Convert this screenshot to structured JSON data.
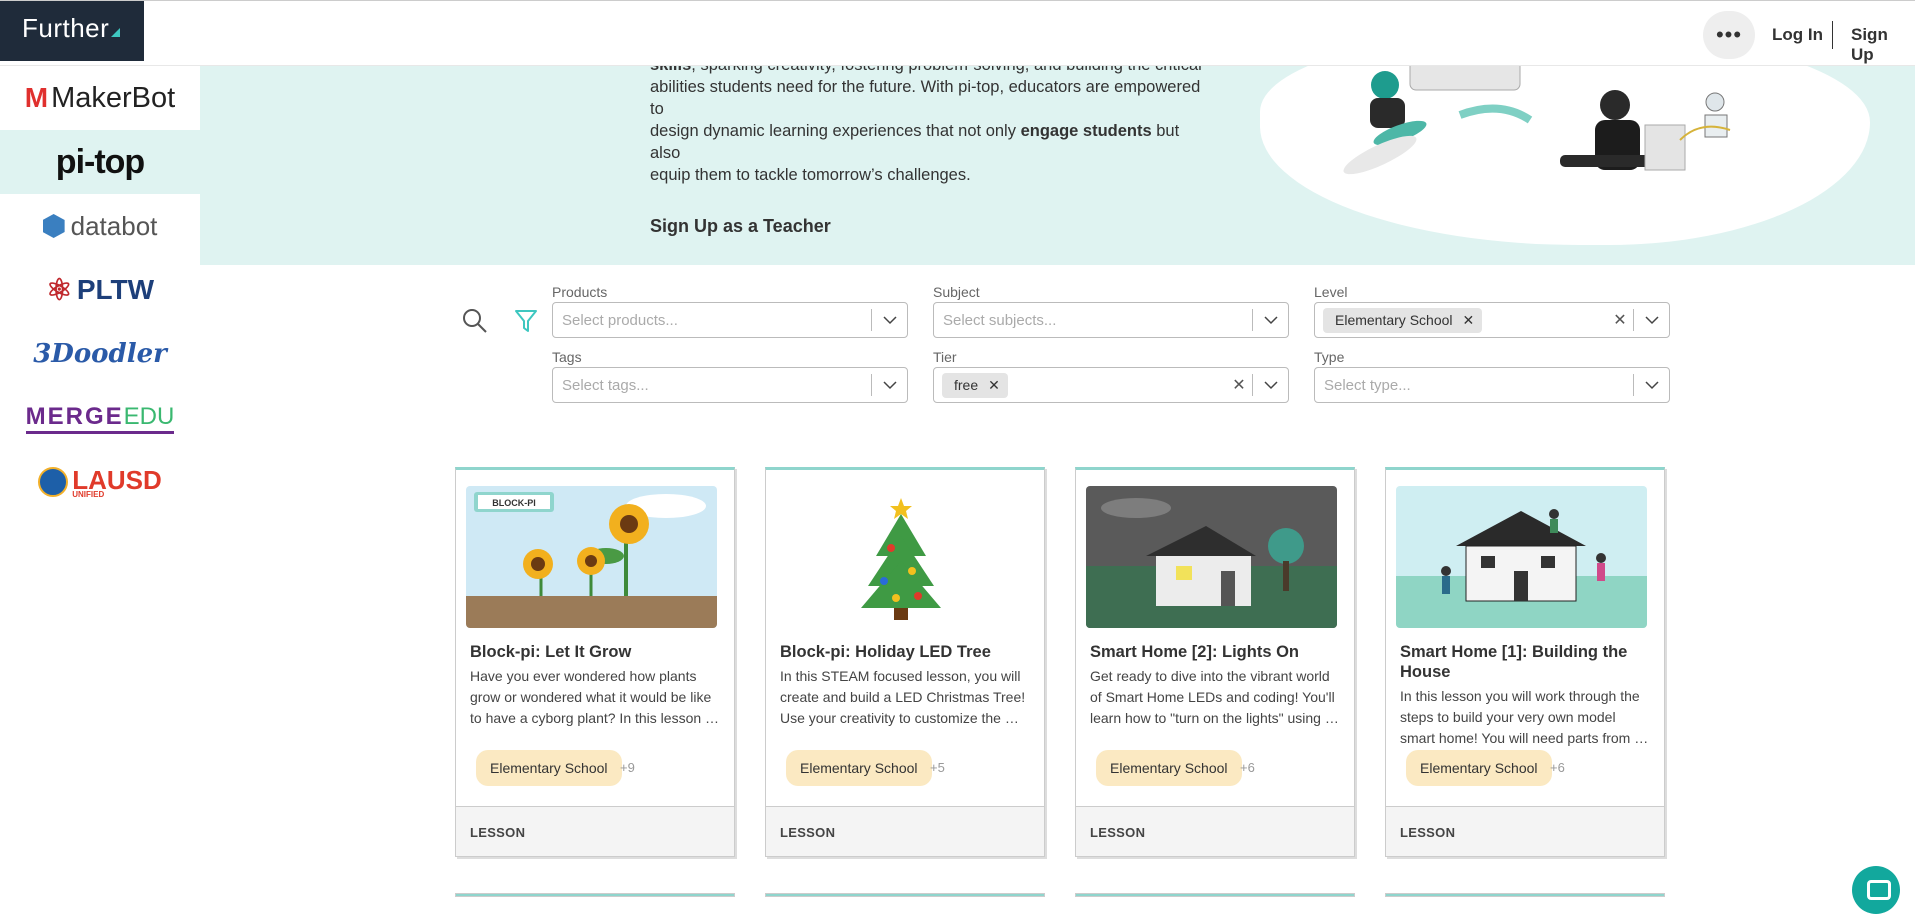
{
  "header": {
    "brand": "Further",
    "more_icon": "ellipsis-icon",
    "login": "Log In",
    "signup": "Sign Up"
  },
  "sidebar": {
    "items": [
      {
        "label": "MakerBot",
        "active": false
      },
      {
        "label": "pi-top",
        "active": true
      },
      {
        "label": "databot",
        "active": false
      },
      {
        "label": "PLTW",
        "active": false
      },
      {
        "label": "3Doodler",
        "active": false
      },
      {
        "label": "MERGE",
        "suffix": "EDU",
        "active": false
      },
      {
        "label": "LAUSD",
        "sub": "UNIFIED",
        "active": false
      }
    ]
  },
  "hero": {
    "line1_bold": "skills",
    "line1_rest": ", sparking creativity, fostering problem-solving, and building the critical",
    "line2": "abilities students need for the future. With pi-top, educators are empowered to",
    "line3_pre": "design dynamic learning experiences that not only ",
    "line3_bold": "engage students",
    "line3_post": " but also",
    "line4": "equip them to tackle tomorrow’s challenges.",
    "cta": "Sign Up as a Teacher"
  },
  "filters": {
    "products": {
      "label": "Products",
      "placeholder": "Select products..."
    },
    "subject": {
      "label": "Subject",
      "placeholder": "Select subjects..."
    },
    "level": {
      "label": "Level",
      "value": "Elementary School"
    },
    "tags": {
      "label": "Tags",
      "placeholder": "Select tags..."
    },
    "tier": {
      "label": "Tier",
      "value": "free"
    },
    "type": {
      "label": "Type",
      "placeholder": "Select type..."
    }
  },
  "cards": [
    {
      "title": "Block-pi: Let It Grow",
      "badge": "BLOCK-PI",
      "desc": [
        "Have you ever wondered how plants",
        "grow or wondered what it would be like",
        "to have a cyborg plant? In this lesson yo…"
      ],
      "tag": "Elementary School",
      "more": "+9",
      "type": "LESSON"
    },
    {
      "title": "Block-pi: Holiday LED Tree",
      "desc": [
        "In this STEAM focused lesson, you will",
        "create and build a LED Christmas Tree!",
        "Use your creativity to customize the …"
      ],
      "tag": "Elementary School",
      "more": "+5",
      "type": "LESSON"
    },
    {
      "title": "Smart Home [2]: Lights On",
      "desc": [
        "Get ready to dive into the vibrant world",
        "of Smart Home LEDs and coding! You'll",
        "learn how to \"turn on the lights\" using …"
      ],
      "tag": "Elementary School",
      "more": "+6",
      "type": "LESSON"
    },
    {
      "title_line1": "Smart Home [1]: Building the",
      "title_line2": "House",
      "desc": [
        "In this lesson you will work through the",
        "steps to build your very own model",
        "smart home! You will need parts from …"
      ],
      "tag": "Elementary School",
      "more": "+6",
      "type": "LESSON"
    }
  ],
  "colors": {
    "brand_bg": "#1f2b3a",
    "hero_bg": "#dff3f1",
    "accent": "#3ec7c0",
    "tag_bg": "#fbe9c2",
    "chat": "#12a89d"
  }
}
